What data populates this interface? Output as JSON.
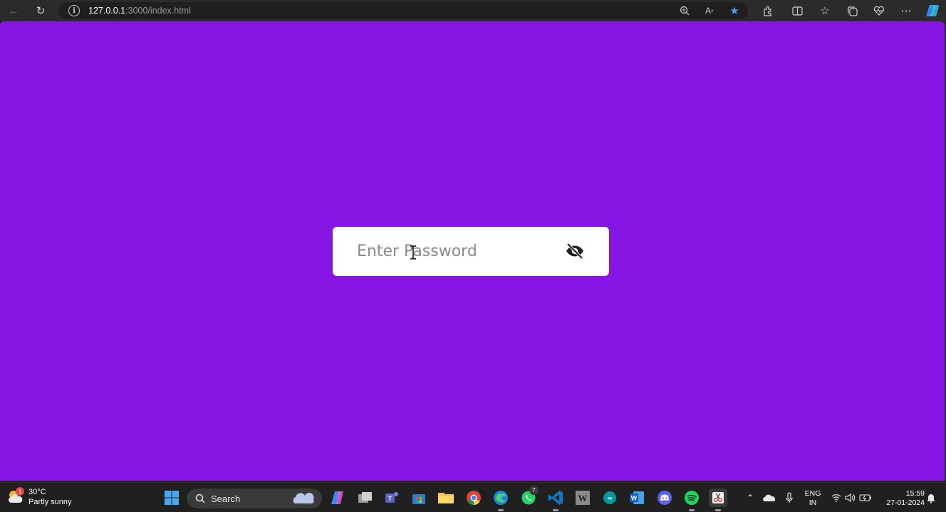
{
  "browser": {
    "url_host": "127.0.0.1",
    "url_rest": ":3000/index.html"
  },
  "page": {
    "background": "#8614e2",
    "password_placeholder": "Enter Password"
  },
  "taskbar": {
    "weather_temp": "30°C",
    "weather_desc": "Partly sunny",
    "weather_badge": "1",
    "search_label": "Search",
    "whatsapp_badge": "7",
    "lang_top": "ENG",
    "lang_bottom": "IN",
    "time": "15:59",
    "date": "27-01-2024"
  }
}
